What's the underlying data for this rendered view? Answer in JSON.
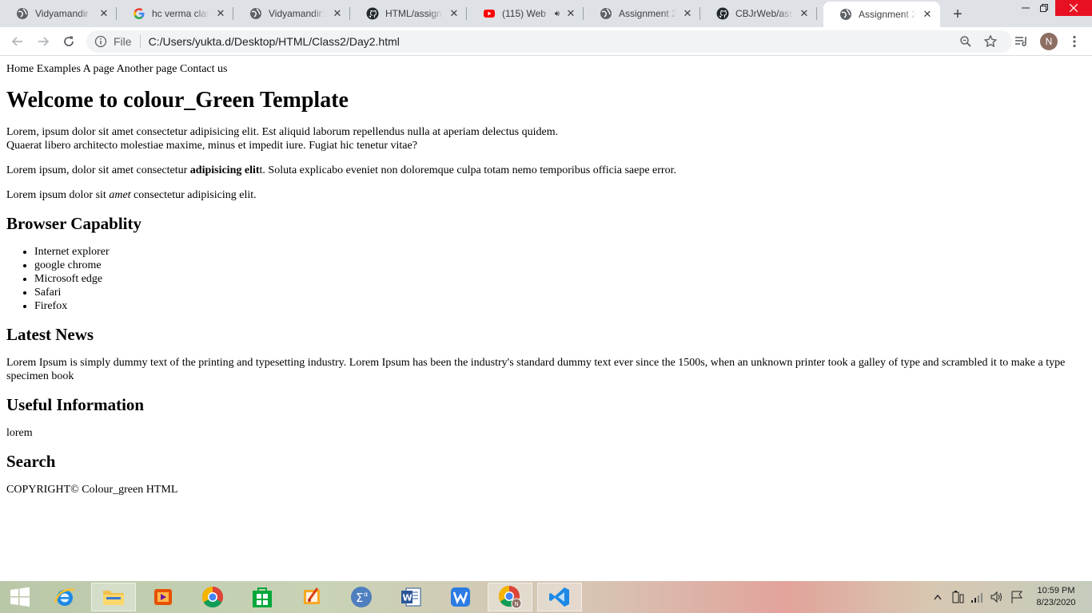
{
  "browser": {
    "tabs": [
      {
        "title": "Vidyamandir",
        "icon": "globe-icon",
        "active": false
      },
      {
        "title": "hc verma class",
        "icon": "google-icon",
        "active": false
      },
      {
        "title": "Vidyamandir:M",
        "icon": "globe-icon",
        "active": false
      },
      {
        "title": "HTML/assignm",
        "icon": "github-icon",
        "active": false
      },
      {
        "title": "(115) Web",
        "icon": "youtube-icon",
        "active": false,
        "audio": true
      },
      {
        "title": "Assignment 2",
        "icon": "globe-icon",
        "active": false
      },
      {
        "title": "CBJrWeb/assig",
        "icon": "github-icon",
        "active": false
      },
      {
        "title": "Assignment 2",
        "icon": "globe-icon",
        "active": true
      }
    ],
    "address": {
      "scheme": "File",
      "url": "C:/Users/yukta.d/Desktop/HTML/Class2/Day2.html"
    },
    "profile_initial": "N"
  },
  "page": {
    "nav": [
      "Home",
      "Examples",
      "A page",
      "Another page",
      "Contact us"
    ],
    "heading": "Welcome to colour_Green Template",
    "para1_line1": "Lorem, ipsum dolor sit amet consectetur adipisicing elit. Est aliquid laborum repellendus nulla at aperiam delectus quidem.",
    "para1_line2": "Quaerat libero architecto molestiae maxime, minus et impedit iure. Fugiat hic tenetur vitae?",
    "para2_before": "Lorem ipsum, dolor sit amet consectetur ",
    "para2_bold": "adipisicing elit",
    "para2_after": "t. Soluta explicabo eveniet non doloremque culpa totam nemo temporibus officia saepe error.",
    "para3_before": "Lorem ipsum dolor sit ",
    "para3_italic": "amet",
    "para3_after": " consectetur adipisicing elit.",
    "browser_heading": "Browser Capablity",
    "browsers": [
      "Internet explorer",
      "google chrome",
      "Microsoft edge",
      "Safari",
      "Firefox"
    ],
    "news_heading": "Latest News",
    "news_text": "Lorem Ipsum is simply dummy text of the printing and typesetting industry. Lorem Ipsum has been the industry's standard dummy text ever since the 1500s, when an unknown printer took a galley of type and scrambled it to make a type specimen book",
    "info_heading": "Useful Information",
    "info_text": "lorem",
    "search_heading": "Search",
    "footer": "COPYRIGHT© Colour_green HTML"
  },
  "taskbar": {
    "apps": [
      "windows-start-icon",
      "internet-explorer-icon",
      "file-explorer-icon",
      "media-player-icon",
      "chrome-icon",
      "store-icon",
      "paint-icon",
      "math-input-icon",
      "word-icon",
      "wps-writer-icon",
      "chrome-profile-icon",
      "vscode-icon"
    ],
    "time": "10:59 PM",
    "date": "8/23/2020"
  }
}
